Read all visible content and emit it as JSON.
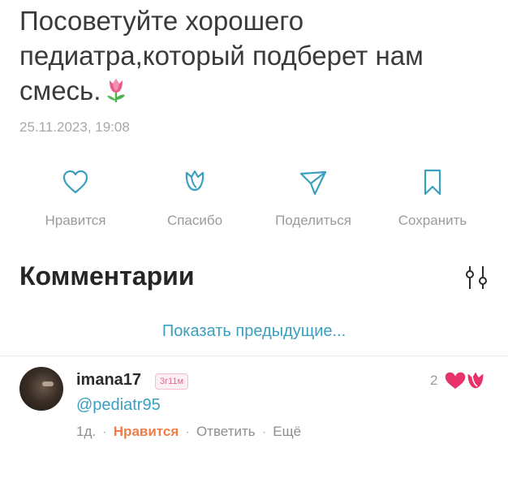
{
  "post": {
    "text": "Посоветуйте хорошего педиатра,который подберет нам смесь.",
    "emoji_icon": "tulip-icon",
    "date": "25.11.2023, 19:08"
  },
  "actions": [
    {
      "label": "Нравится",
      "icon": "heart-icon"
    },
    {
      "label": "Спасибо",
      "icon": "tulip-outline-icon"
    },
    {
      "label": "Поделиться",
      "icon": "share-icon"
    },
    {
      "label": "Сохранить",
      "icon": "bookmark-icon"
    }
  ],
  "comments": {
    "title": "Комментарии",
    "filter_icon": "filter-icon",
    "show_previous": "Показать предыдущие...",
    "items": [
      {
        "username": "imana17",
        "badge": "3г11м",
        "mention": "@pediatr95",
        "time": "1д.",
        "like_label": "Нравится",
        "reply_label": "Ответить",
        "more_label": "Ещё",
        "reaction_count": "2",
        "reaction_icons": [
          "heart-icon",
          "tulip-icon"
        ]
      }
    ]
  },
  "colors": {
    "link": "#3aa0bd",
    "like_active": "#ef7d45",
    "reaction_pink": "#e8336a"
  }
}
